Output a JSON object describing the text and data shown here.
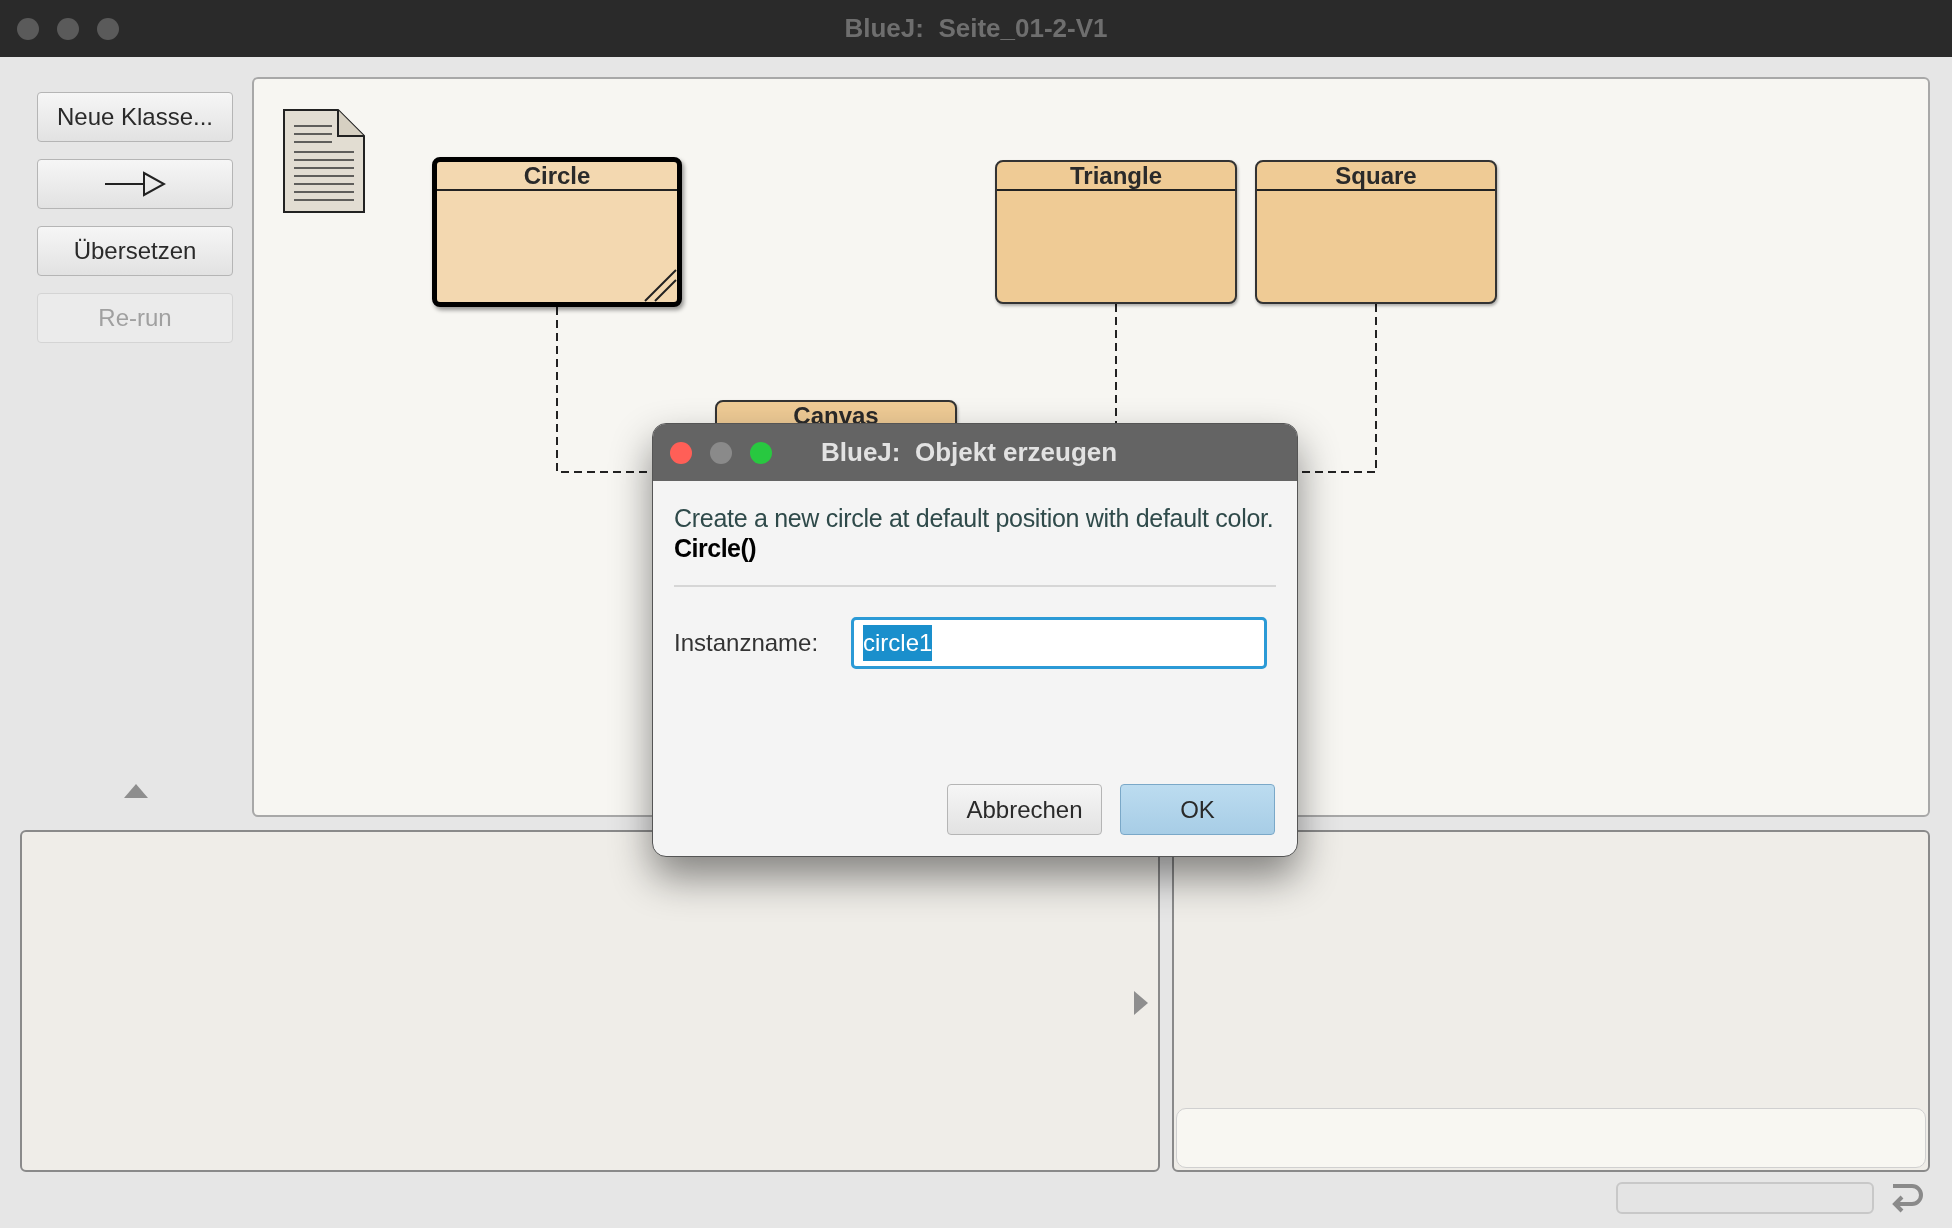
{
  "window": {
    "title": "BlueJ:  Seite_01-2-V1"
  },
  "toolbar": [
    {
      "kind": "text",
      "label": "Neue Klasse...",
      "disabled": false
    },
    {
      "kind": "arrow",
      "disabled": false
    },
    {
      "kind": "text",
      "label": "Übersetzen",
      "disabled": false
    },
    {
      "kind": "text",
      "label": "Re-run",
      "disabled": true
    }
  ],
  "classes": [
    {
      "name": "Circle",
      "selected": true,
      "uncompiled": true
    },
    {
      "name": "Triangle",
      "selected": false,
      "uncompiled": false
    },
    {
      "name": "Square",
      "selected": false,
      "uncompiled": false
    },
    {
      "name": "Canvas",
      "selected": false
    }
  ],
  "dialog": {
    "title": "BlueJ:  Objekt erzeugen",
    "description": "Create a new circle at default position with default color.",
    "signature": "Circle()",
    "field_label": "Instanzname:",
    "field_value": "circle1",
    "value_selected": true,
    "buttons": [
      {
        "label": "Abbrechen",
        "default": false
      },
      {
        "label": "OK",
        "default": true
      }
    ]
  }
}
